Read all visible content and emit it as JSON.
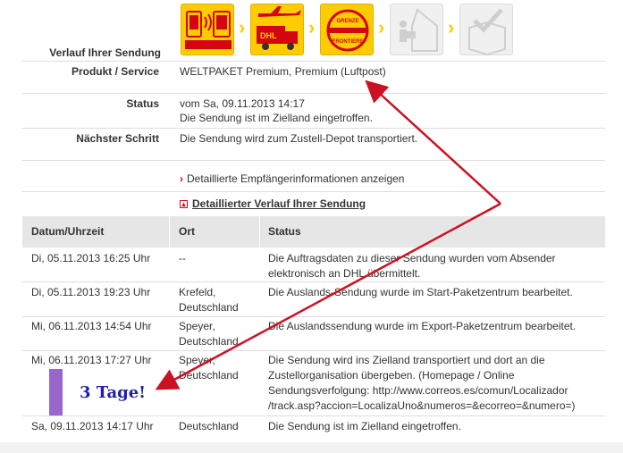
{
  "header": {
    "verlauf_label": "Verlauf Ihrer Sendung",
    "steps": [
      {
        "name": "order-data-step-icon",
        "state": "active"
      },
      {
        "name": "transport-step-icon",
        "state": "active"
      },
      {
        "name": "border-step-icon",
        "state": "active",
        "badge_top": "GRENZE",
        "badge_bottom": "FRONTIERE"
      },
      {
        "name": "delivery-step-icon",
        "state": "inactive"
      },
      {
        "name": "delivered-step-icon",
        "state": "inactive"
      }
    ]
  },
  "details": {
    "produkt_label": "Produkt / Service",
    "produkt_value": "WELTPAKET Premium, Premium (Luftpost)",
    "status_label": "Status",
    "status_line1": "vom Sa, 09.11.2013 14:17",
    "status_line2": "Die Sendung ist im Zielland eingetroffen.",
    "next_label": "Nächster Schritt",
    "next_value": "Die Sendung wird zum Zustell-Depot transportiert.",
    "link_recipient": "Detaillierte Empfängerinformationen anzeigen",
    "link_history": "Detaillierter Verlauf Ihrer Sendung"
  },
  "table": {
    "headers": [
      "Datum/Uhrzeit",
      "Ort",
      "Status"
    ],
    "rows": [
      {
        "date": "Di, 05.11.2013 16:25 Uhr",
        "ort1": "--",
        "ort2": "",
        "status": [
          "Die Auftragsdaten zu dieser Sendung wurden vom Absender",
          "elektronisch an DHL übermittelt."
        ]
      },
      {
        "date": "Di, 05.11.2013 19:23 Uhr",
        "ort1": "Krefeld,",
        "ort2": "Deutschland",
        "status": [
          "Die Auslands-Sendung wurde im Start-Paketzentrum bearbeitet."
        ]
      },
      {
        "date": "Mi, 06.11.2013 14:54 Uhr",
        "ort1": "Speyer,",
        "ort2": "Deutschland",
        "status": [
          "Die Auslandssendung wurde im Export-Paketzentrum bearbeitet."
        ]
      },
      {
        "date": "Mi, 06.11.2013 17:27 Uhr",
        "ort1": "Speyer,",
        "ort2": "Deutschland",
        "status": [
          "Die Sendung wird ins Zielland transportiert und dort an die",
          "Zustellorganisation übergeben. (Homepage / Online",
          "Sendungsverfolgung: http://www.correos.es/comun/Localizador",
          "/track.asp?accion=LocalizaUno&numeros=&ecorreo=&numero=)"
        ]
      },
      {
        "date": "Sa, 09.11.2013 14:17 Uhr",
        "ort1": "Deutschland",
        "ort2": "",
        "status": [
          "Die Sendung ist im Zielland eingetroffen."
        ]
      }
    ]
  },
  "annotation": {
    "text": "3 Tage!",
    "arrow_color": "#cc1122",
    "bar_color": "#9966cc"
  },
  "colors": {
    "dhl_yellow": "#ffcc00",
    "dhl_red": "#d40511"
  }
}
